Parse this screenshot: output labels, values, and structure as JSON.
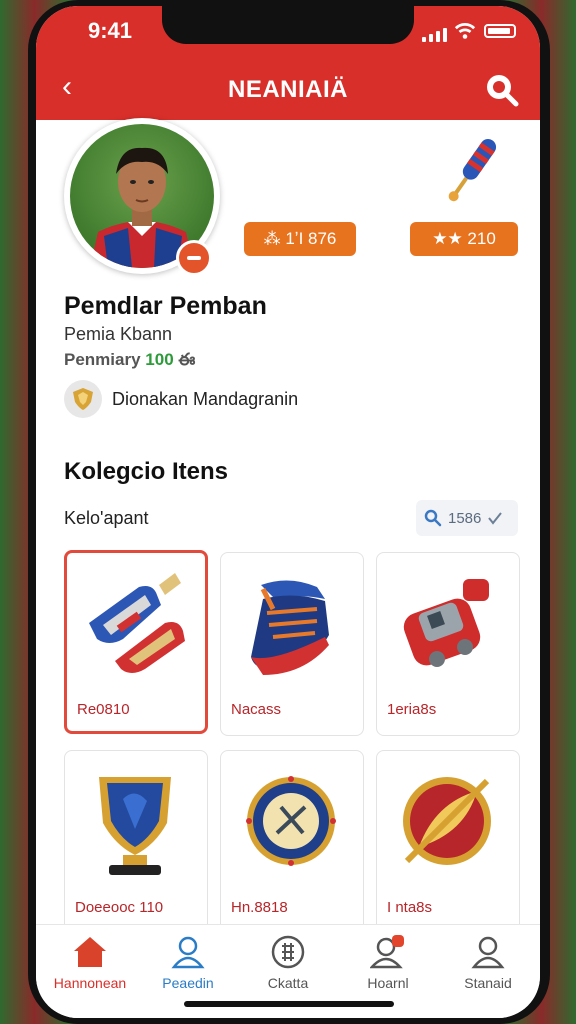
{
  "status": {
    "time": "9:41"
  },
  "header": {
    "title": "NEANIAIÄ"
  },
  "profile": {
    "stat_1": "⁂ 1ʼI 876",
    "stat_2": "★★ 210",
    "name": "Pemdlar Pemban",
    "subtitle": "Pemia Kbann",
    "rank_label": "Penmiary",
    "rank_value": "100",
    "rank_suffix": "ఈ",
    "badge_text": "Dionakan Mandagranin"
  },
  "collection": {
    "title": "Kolegcio Itens",
    "filter_label": "Kelo'apant",
    "filter_value": "1586",
    "items": [
      {
        "label": "Re0810",
        "icon": "gloves-icon",
        "selected": true
      },
      {
        "label": "Nacass",
        "icon": "boot-icon",
        "selected": false
      },
      {
        "label": "1eria8s",
        "icon": "gadget-icon",
        "selected": false
      },
      {
        "label": "Doeeooc 110",
        "icon": "shield-trophy-icon",
        "selected": false
      },
      {
        "label": "Hn.8818",
        "icon": "medal-icon",
        "selected": false
      },
      {
        "label": "I nta8s",
        "icon": "feather-medal-icon",
        "selected": false
      }
    ]
  },
  "tabs": [
    {
      "label": "Hannonean",
      "icon": "home-icon"
    },
    {
      "label": "Peaedin",
      "icon": "profile-icon"
    },
    {
      "label": "Ckatta",
      "icon": "grid-icon"
    },
    {
      "label": "Hoarnl",
      "icon": "notification-icon"
    },
    {
      "label": "Stanaid",
      "icon": "user-icon"
    }
  ],
  "colors": {
    "primary": "#d92f2a",
    "accent": "#e8731e",
    "blue": "#2a7cc7",
    "green": "#2e9b3a"
  }
}
